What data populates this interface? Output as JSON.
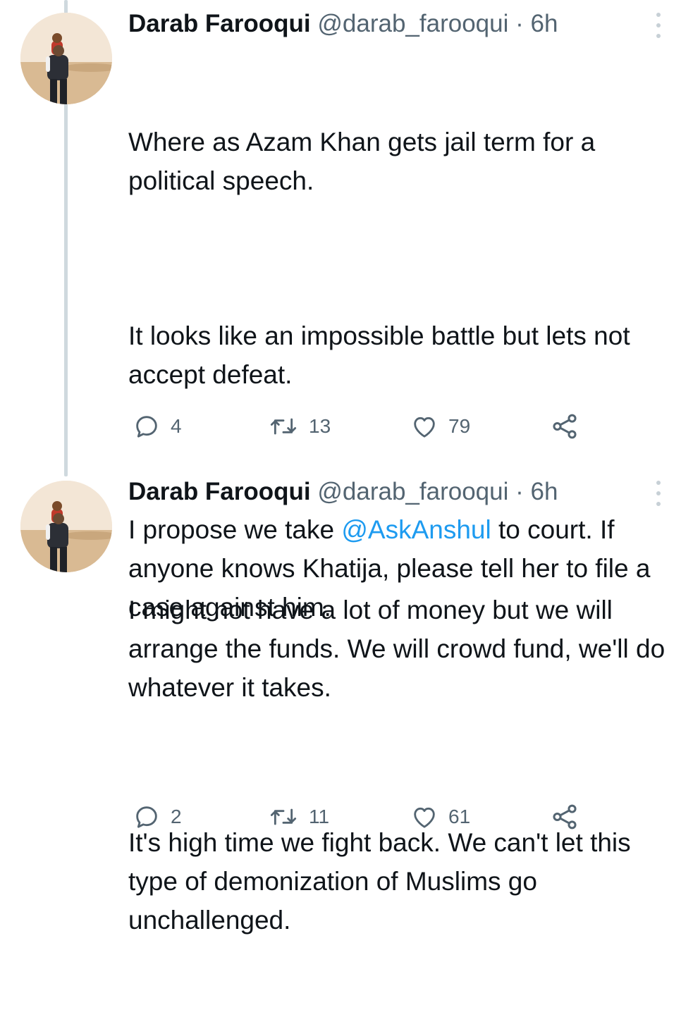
{
  "tweets": [
    {
      "author": {
        "name": "Darab Farooqui",
        "handle": "@darab_farooqui",
        "separator": "·",
        "time": "6h"
      },
      "paragraphs": [
        [
          {
            "text": "Where as Azam Khan gets jail term for a political speech."
          }
        ],
        [
          {
            "text": "It looks like an impossible battle but lets not accept defeat."
          }
        ],
        [
          {
            "text": "I propose we take "
          },
          {
            "text": "@AskAnshul",
            "mention": true
          },
          {
            "text": " to court. If anyone knows Khatija, please tell her to file a case against him."
          }
        ]
      ],
      "actions": {
        "replies": "4",
        "retweets": "13",
        "likes": "79"
      }
    },
    {
      "author": {
        "name": "Darab Farooqui",
        "handle": "@darab_farooqui",
        "separator": "·",
        "time": "6h"
      },
      "paragraphs": [
        [
          {
            "text": "I might not have a lot of money but we will arrange the funds. We will crowd fund, we'll do whatever it takes."
          }
        ],
        [
          {
            "text": "It's high time we fight back. We can't let this type of demonization of Muslims go unchallenged."
          }
        ]
      ],
      "actions": {
        "replies": "2",
        "retweets": "11",
        "likes": "61"
      }
    }
  ],
  "icons": {
    "reply": "reply-icon",
    "retweet": "retweet-icon",
    "like": "like-icon",
    "share": "share-icon",
    "more": "more-icon"
  },
  "colors": {
    "text": "#0f1419",
    "secondary": "#536471",
    "mention": "#1d9bf0",
    "thread_line": "#cfd9de"
  }
}
